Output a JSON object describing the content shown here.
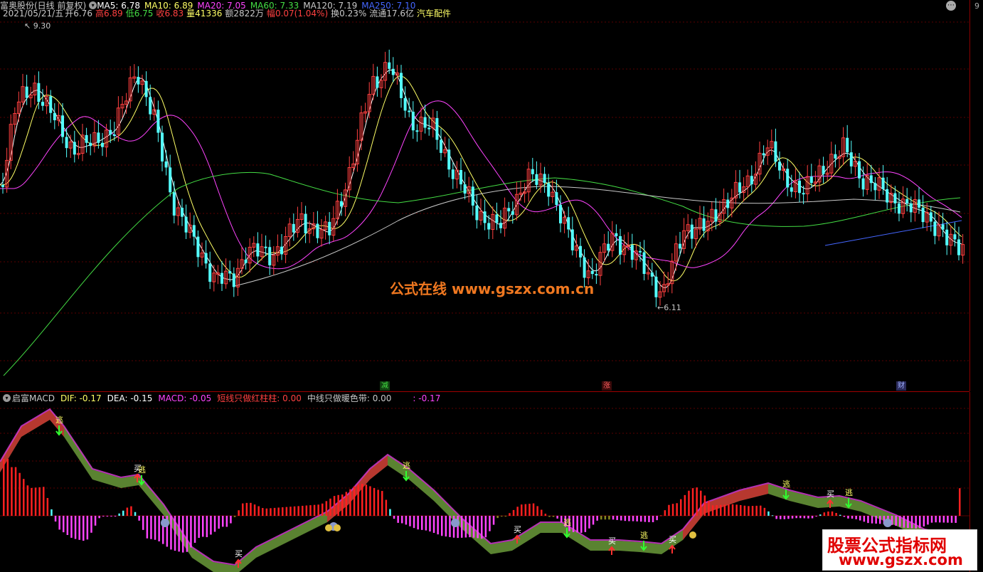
{
  "header": {
    "title": "富奥股份(日线 前复权)",
    "ma": [
      {
        "label": "MA5: 6.78",
        "color": "#ffffff"
      },
      {
        "label": "MA10: 6.89",
        "color": "#ffff66"
      },
      {
        "label": "MA20: 7.05",
        "color": "#ff44ff"
      },
      {
        "label": "MA60: 7.33",
        "color": "#44dd44"
      },
      {
        "label": "MA120: 7.19",
        "color": "#c8c8c8"
      },
      {
        "label": "MA250: 7.10",
        "color": "#4466ff"
      }
    ]
  },
  "info": {
    "date": "2021/05/21/五",
    "open_label": "开",
    "open": "6.76",
    "high_label": "高",
    "high": "6.89",
    "low_label": "低",
    "low": "6.75",
    "close_label": "收",
    "close": "6.83",
    "volume_label": "量",
    "volume": "41336",
    "amount_label": "额",
    "amount": "2822万",
    "change_label": "幅",
    "change": "0.07(1.04%)",
    "turnover_label": "换",
    "turnover": "0.23%",
    "float_label": "流通",
    "float": "17.6亿",
    "industry": "汽车配件"
  },
  "price_labels": {
    "max": "9.30",
    "min": "6.11"
  },
  "axis_digit": "9",
  "watermark": "公式在线  www.gszx.com.cn",
  "event_badges": {
    "reduce": "减",
    "rise": "涨",
    "finance": "财"
  },
  "macd": {
    "title": "启富MACD",
    "dif": "DIF: -0.17",
    "dea": "DEA: -0.15",
    "macd": "MACD: -0.05",
    "short_line": "短线只做红柱柱: 0.00",
    "mid_line": "中线只做暖色带: 0.00",
    "extra": ": -0.17"
  },
  "signals": {
    "buy": "买",
    "escape": "逃"
  },
  "brand": {
    "line1": "股票公式指标网",
    "line2": "www.gszx.com"
  },
  "colors": {
    "up": "#ff4040",
    "down": "#54ffff",
    "ma5": "#ffffff",
    "ma10": "#ffff66",
    "ma20": "#ff44ff",
    "ma60": "#44dd44",
    "ma120": "#c8c8c8",
    "ma250": "#4466ff",
    "macd_pos": "#ff2020",
    "macd_neg_warm": "#ff44ff",
    "macd_neg_cool": "#888820",
    "band_red": "#c03030",
    "band_green": "#6a9a3a"
  }
}
